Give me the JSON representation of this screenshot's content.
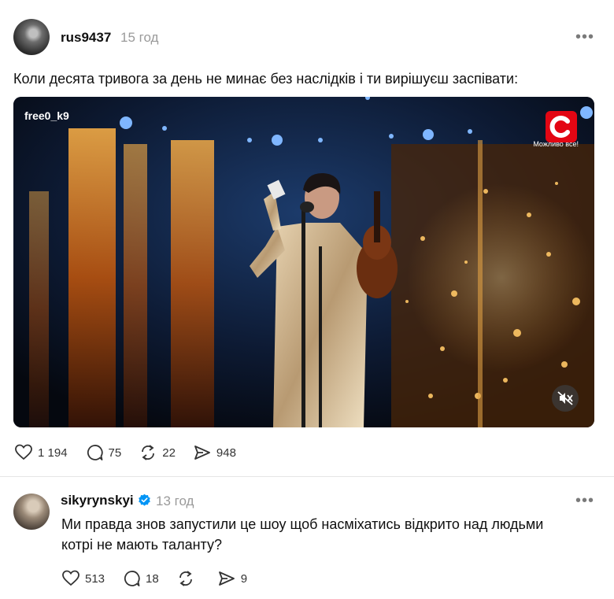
{
  "post": {
    "username": "rus9437",
    "time": "15 год",
    "text": "Коли десята тривога за день не минає без наслідків і ти вирішуєш заспівати:",
    "media": {
      "watermark": "free0_k9",
      "channel_logo_letter": "С",
      "channel_tagline": "Можливо все!"
    },
    "stats": {
      "likes": "1 194",
      "replies": "75",
      "reposts": "22",
      "shares": "948"
    }
  },
  "reply": {
    "username": "sikyrynskyi",
    "time": "13 год",
    "verified": true,
    "text_line1": "Ми правда знов запустили це шоу щоб насміхатись відкрито над людьми",
    "text_line2": "котрі не мають таланту?",
    "stats": {
      "likes": "513",
      "replies": "18",
      "reposts": "",
      "shares": "9"
    }
  },
  "colors": {
    "verified_badge": "#0095f6",
    "logo_red": "#e30613",
    "muted_text": "#9a9a9a"
  }
}
